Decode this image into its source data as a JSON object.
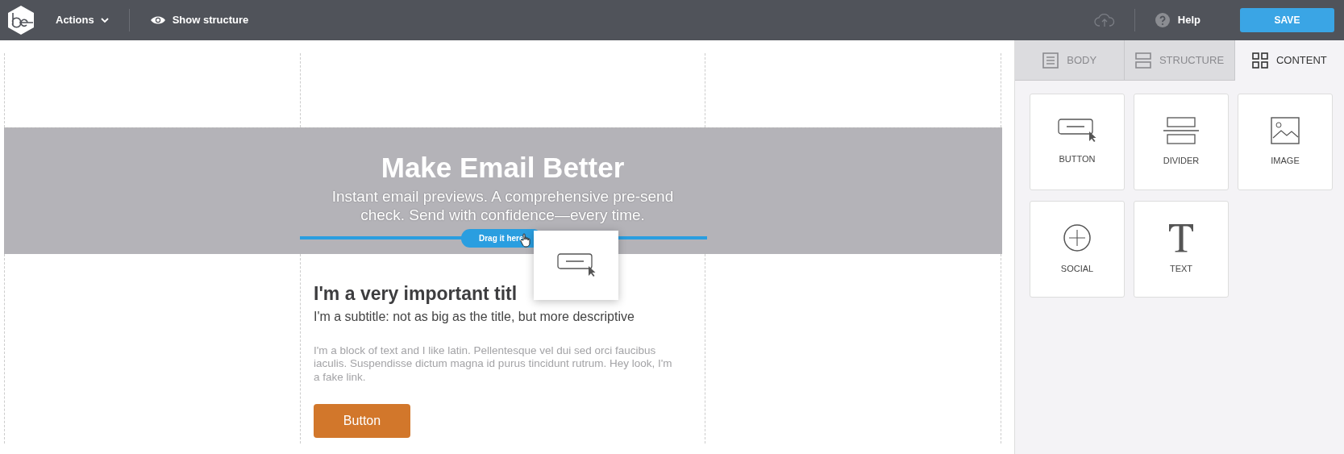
{
  "topbar": {
    "actions": "Actions",
    "show_structure": "Show structure",
    "help": "Help",
    "save": "SAVE"
  },
  "email": {
    "header_title": "Make Email Better",
    "header_text": "Instant email previews. A comprehensive pre-send check. Send with confidence—every time.",
    "drop_hint": "Drag it here",
    "title": "I'm a very important titl",
    "subtitle": "I'm a subtitle: not as big as the title, but more descriptive",
    "body": "I'm a block of text and I like latin. Pellentesque vel dui sed orci faucibus iaculis. Suspendisse dictum magna id purus tincidunt rutrum. Hey look, I'm a fake link.",
    "button": "Button"
  },
  "dragged_item": {
    "kind": "button"
  },
  "tabs": [
    {
      "label": "BODY",
      "kind": "body",
      "selected": false
    },
    {
      "label": "STRUCTURE",
      "kind": "structure",
      "selected": false
    },
    {
      "label": "CONTENT",
      "kind": "content",
      "selected": true
    }
  ],
  "content_tiles": [
    {
      "label": "BUTTON",
      "kind": "button"
    },
    {
      "label": "DIVIDER",
      "kind": "divider"
    },
    {
      "label": "IMAGE",
      "kind": "image"
    },
    {
      "label": "SOCIAL",
      "kind": "social"
    },
    {
      "label": "TEXT",
      "kind": "text"
    }
  ]
}
